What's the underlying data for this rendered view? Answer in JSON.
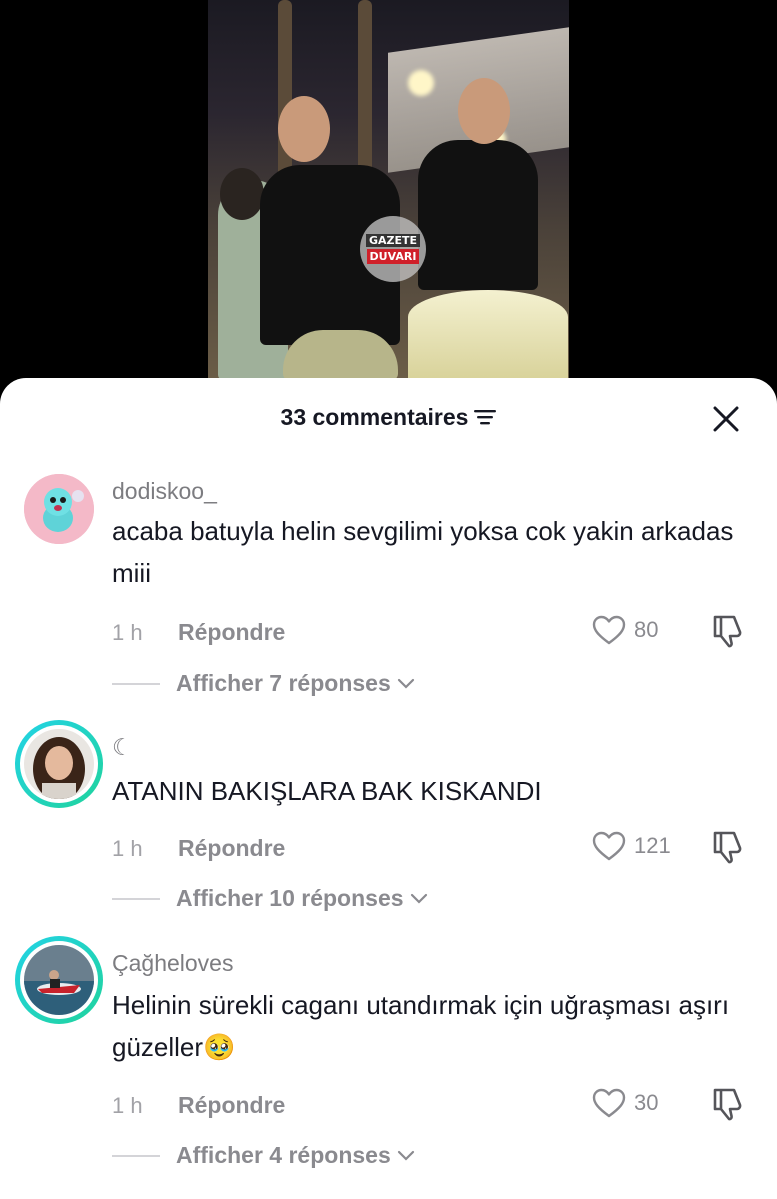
{
  "video": {
    "watermark_line1": "GAZETE",
    "watermark_line2": "DUVARI"
  },
  "sheet": {
    "title": "33 commentaires"
  },
  "comments": [
    {
      "username": "dodiskoo_",
      "text": "acaba batuyla helin sevgilimi yoksa cok yakin arkadas miii",
      "time": "1 h",
      "reply_label": "Répondre",
      "likes": "80",
      "replies_label": "Afficher 7 réponses"
    },
    {
      "username": "☾",
      "text": "ATANIN BAKIŞLARA BAK KISKANDI",
      "time": "1 h",
      "reply_label": "Répondre",
      "likes": "121",
      "replies_label": "Afficher 10 réponses"
    },
    {
      "username": "Çağheloves",
      "text": "Helinin sürekli caganı utandırmak için uğraşması aşırı güzeller🥹",
      "time": "1 h",
      "reply_label": "Répondre",
      "likes": "30",
      "replies_label": "Afficher 4 réponses"
    }
  ],
  "colors": {
    "story_ring_start": "#23d3e6",
    "story_ring_end": "#20d39c",
    "secondary_text": "#8a8a8f"
  },
  "icons": [
    "sort-icon",
    "close-icon",
    "heart-icon",
    "dislike-icon",
    "chevron-down-icon"
  ]
}
